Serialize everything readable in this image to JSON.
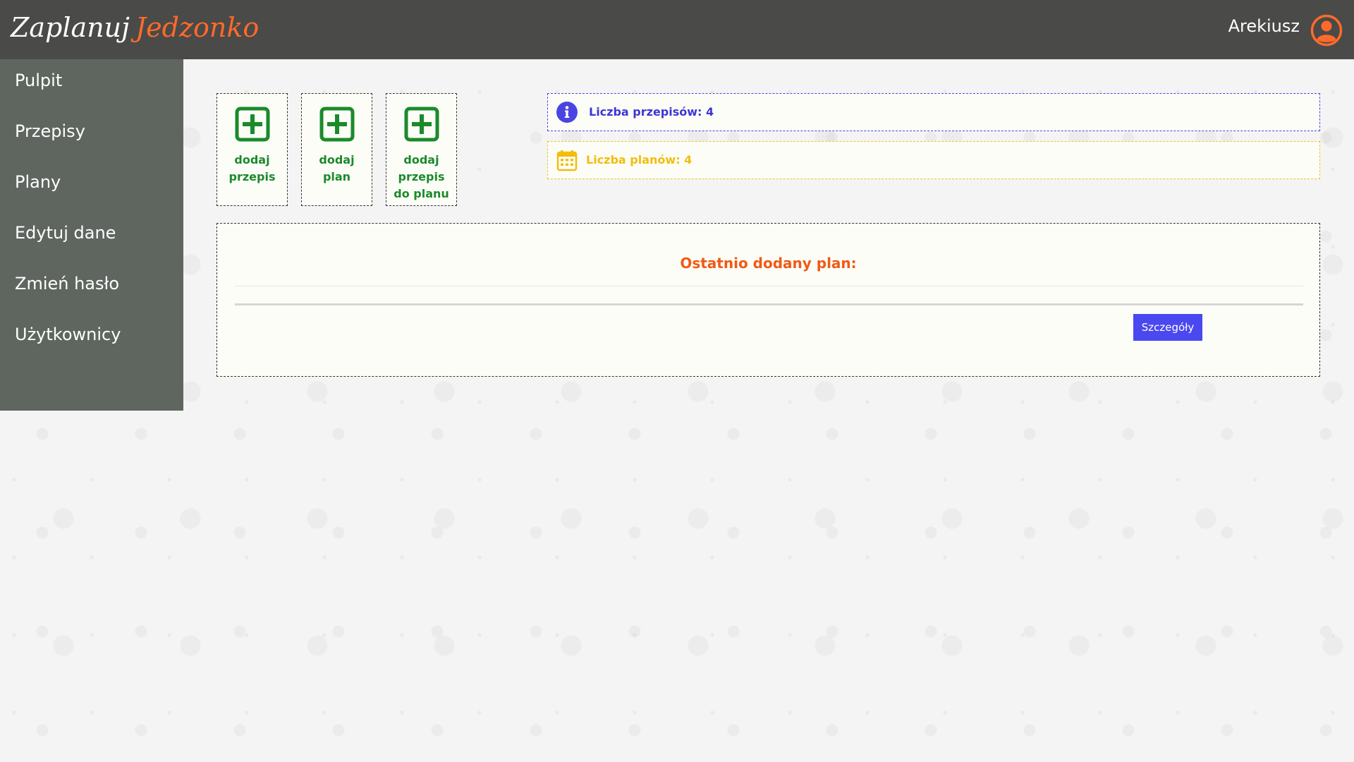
{
  "app": {
    "logo_part1": "Zaplanuj",
    "logo_part2": "Jedzonko"
  },
  "header": {
    "user_name": "Arekiusz",
    "user_icon": "user-circle-icon",
    "accent_color": "#ff6a2a"
  },
  "sidebar": {
    "items": [
      {
        "label": "Pulpit"
      },
      {
        "label": "Przepisy"
      },
      {
        "label": "Plany"
      },
      {
        "label": "Edytuj dane"
      },
      {
        "label": "Zmień hasło"
      },
      {
        "label": "Użytkownicy"
      }
    ]
  },
  "actions": [
    {
      "label": "dodaj przepis",
      "icon": "plus-square-icon"
    },
    {
      "label": "dodaj plan",
      "icon": "plus-square-icon"
    },
    {
      "label": "dodaj przepis do planu",
      "icon": "plus-square-icon"
    }
  ],
  "stats": {
    "recipes": {
      "text": "Liczba przepisów: 4",
      "icon": "info-icon",
      "color": "#3d36d6"
    },
    "plans": {
      "text": "Liczba planów: 4",
      "icon": "calendar-icon",
      "color": "#f2bd0c"
    }
  },
  "last_plan": {
    "title": "Ostatnio dodany plan:",
    "button_label": "Szczegóły",
    "title_color": "#f05a14",
    "button_color": "#4a48ee"
  }
}
